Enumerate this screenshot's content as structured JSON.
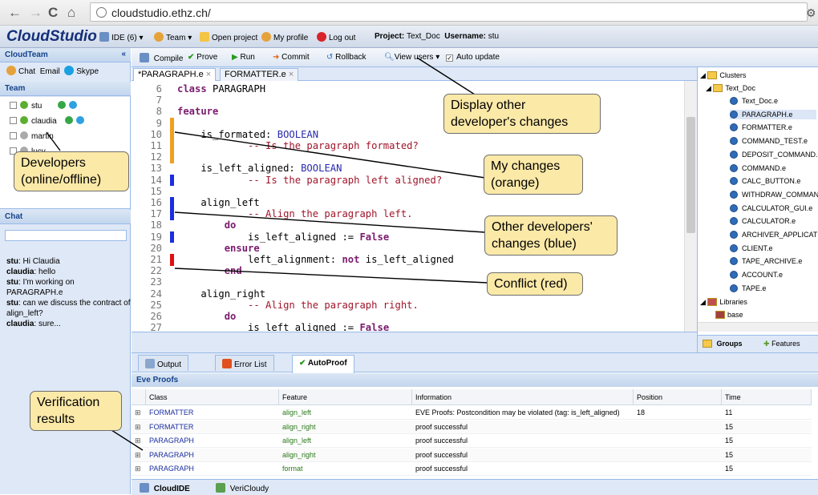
{
  "browser": {
    "url": "cloudstudio.ethz.ch/"
  },
  "appbar": {
    "logo": "CloudStudio",
    "items": [
      "IDE (6) ▾",
      "Team ▾",
      "Open project",
      "My profile",
      "Log out"
    ],
    "project_label": "Project:",
    "project_value": "Text_Doc",
    "username_label": "Username:",
    "username_value": "stu"
  },
  "left": {
    "title": "CloudTeam",
    "links": [
      "Chat",
      "Email",
      "Skype"
    ],
    "team_header": "Team",
    "team": [
      {
        "name": "stu",
        "online": true
      },
      {
        "name": "claudia",
        "online": true
      },
      {
        "name": "martin",
        "online": false
      },
      {
        "name": "lucy",
        "online": false
      }
    ],
    "chat_header": "Chat",
    "chat": [
      {
        "who": "stu",
        "msg": ": Hi Claudia"
      },
      {
        "who": "claudia",
        "msg": ": hello"
      },
      {
        "who": "stu",
        "msg": ": I'm working on PARAGRAPH.e"
      },
      {
        "who": "stu",
        "msg": ": can we discuss the contract of align_left?"
      },
      {
        "who": "claudia",
        "msg": ": sure..."
      }
    ]
  },
  "toolbar": {
    "compile": "Compile",
    "prove": "Prove",
    "run": "Run",
    "commit": "Commit",
    "rollback": "Rollback",
    "view_users": "View users ▾",
    "auto_update": "Auto update"
  },
  "tabs": [
    "*PARAGRAPH.e",
    "FORMATTER.e"
  ],
  "editor": {
    "lines": [
      {
        "n": "6",
        "segs": [
          {
            "t": "class",
            "c": "kw"
          },
          {
            "t": " PARAGRAPH",
            "c": ""
          }
        ],
        "mark": ""
      },
      {
        "n": "7",
        "segs": [],
        "mark": ""
      },
      {
        "n": "8",
        "segs": [
          {
            "t": "feature",
            "c": "kw"
          }
        ],
        "mark": ""
      },
      {
        "n": "9",
        "segs": [],
        "mark": "orange"
      },
      {
        "n": "10",
        "segs": [
          {
            "t": "    is_formated: ",
            "c": ""
          },
          {
            "t": "BOOLEAN",
            "c": "ty"
          }
        ],
        "mark": "orange"
      },
      {
        "n": "11",
        "segs": [
          {
            "t": "            -- Is the paragraph formated?",
            "c": "cm"
          }
        ],
        "mark": "orange"
      },
      {
        "n": "12",
        "segs": [],
        "mark": "orange"
      },
      {
        "n": "13",
        "segs": [
          {
            "t": "    is_left_aligned: ",
            "c": ""
          },
          {
            "t": "BOOLEAN",
            "c": "ty"
          }
        ],
        "mark": ""
      },
      {
        "n": "14",
        "segs": [
          {
            "t": "            -- Is the paragraph left aligned?",
            "c": "cm"
          }
        ],
        "mark": "blue"
      },
      {
        "n": "15",
        "segs": [],
        "mark": ""
      },
      {
        "n": "16",
        "segs": [
          {
            "t": "    align_left",
            "c": ""
          }
        ],
        "mark": "blue"
      },
      {
        "n": "17",
        "segs": [
          {
            "t": "            -- Align the paragraph left.",
            "c": "cm"
          }
        ],
        "mark": "blue"
      },
      {
        "n": "18",
        "segs": [
          {
            "t": "        ",
            "c": ""
          },
          {
            "t": "do",
            "c": "kw"
          }
        ],
        "mark": ""
      },
      {
        "n": "19",
        "segs": [
          {
            "t": "            is_left_aligned := ",
            "c": ""
          },
          {
            "t": "False",
            "c": "kw"
          }
        ],
        "mark": "blue"
      },
      {
        "n": "20",
        "segs": [
          {
            "t": "        ",
            "c": ""
          },
          {
            "t": "ensure",
            "c": "kw"
          }
        ],
        "mark": ""
      },
      {
        "n": "21",
        "segs": [
          {
            "t": "            left_alignment: ",
            "c": ""
          },
          {
            "t": "not",
            "c": "kw"
          },
          {
            "t": " is_left_aligned",
            "c": ""
          }
        ],
        "mark": "red"
      },
      {
        "n": "22",
        "segs": [
          {
            "t": "        ",
            "c": ""
          },
          {
            "t": "end",
            "c": "kw"
          }
        ],
        "mark": ""
      },
      {
        "n": "23",
        "segs": [],
        "mark": ""
      },
      {
        "n": "24",
        "segs": [
          {
            "t": "    align_right",
            "c": ""
          }
        ],
        "mark": ""
      },
      {
        "n": "25",
        "segs": [
          {
            "t": "            -- Align the paragraph right.",
            "c": "cm"
          }
        ],
        "mark": ""
      },
      {
        "n": "26",
        "segs": [
          {
            "t": "        ",
            "c": ""
          },
          {
            "t": "do",
            "c": "kw"
          }
        ],
        "mark": ""
      },
      {
        "n": "27",
        "segs": [
          {
            "t": "            is_left_aligned := ",
            "c": ""
          },
          {
            "t": "False",
            "c": "kw"
          }
        ],
        "mark": ""
      }
    ]
  },
  "tree": {
    "clusters": "Clusters",
    "project": "Text_Doc",
    "files": [
      "Text_Doc.e",
      "PARAGRAPH.e",
      "FORMATTER.e",
      "COMMAND_TEST.e",
      "DEPOSIT_COMMAND.e",
      "COMMAND.e",
      "CALC_BUTTON.e",
      "WITHDRAW_COMMAN",
      "CALCULATOR_GUI.e",
      "CALCULATOR.e",
      "ARCHIVER_APPLICATI",
      "CLIENT.e",
      "TAPE_ARCHIVE.e",
      "ACCOUNT.e",
      "TAPE.e"
    ],
    "libraries": "Libraries",
    "base": "base",
    "bottom_tabs": [
      "Groups",
      "Features"
    ]
  },
  "bottom": {
    "tabs": [
      "Output",
      "Error List",
      "AutoProof"
    ],
    "panel_title": "Eve Proofs",
    "columns": [
      "Class",
      "Feature",
      "Information",
      "Position",
      "Time"
    ],
    "rows": [
      {
        "cls": "FORMATTER",
        "feature": "align_left",
        "info": "EVE Proofs: Postcondition may be violated (tag: is_left_aligned)",
        "pos": "18",
        "time": "11"
      },
      {
        "cls": "FORMATTER",
        "feature": "align_right",
        "info": "proof successful",
        "pos": "",
        "time": "15"
      },
      {
        "cls": "PARAGRAPH",
        "feature": "align_left",
        "info": "proof successful",
        "pos": "",
        "time": "15"
      },
      {
        "cls": "PARAGRAPH",
        "feature": "align_right",
        "info": "proof successful",
        "pos": "",
        "time": "15"
      },
      {
        "cls": "PARAGRAPH",
        "feature": "format",
        "info": "proof successful",
        "pos": "",
        "time": "15"
      }
    ],
    "footer_tabs": [
      "CloudIDE",
      "VeriCloudy"
    ]
  },
  "callouts": {
    "display_other": "Display other developer's changes",
    "my_changes": "My changes (orange)",
    "other_changes": "Other developers' changes (blue)",
    "conflict": "Conflict (red)",
    "developers": "Developers (online/offline)",
    "verification": "Verification results"
  },
  "colors": {
    "accent": "#15428b",
    "orange": "#f0a020",
    "blue": "#1a2ee0",
    "red": "#e01010",
    "callout": "#fbe9a8"
  }
}
